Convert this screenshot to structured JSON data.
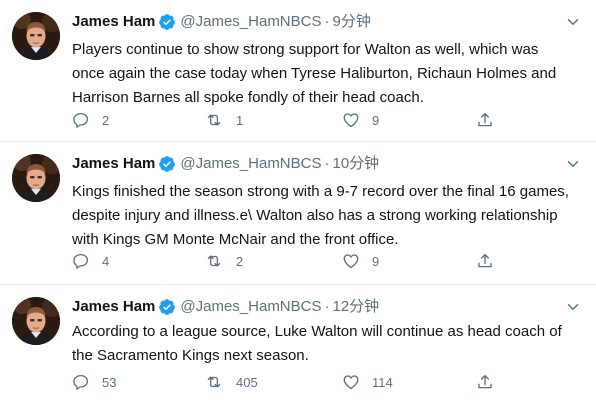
{
  "tweets": [
    {
      "name": "James Ham",
      "handle": "@James_HamNBCS",
      "dot": "·",
      "time": "9分钟",
      "text": "Players continue to show strong support for Walton as well, which was once again the case today when Tyrese Haliburton, Richaun Holmes and Harrison Barnes all spoke fondly of their head coach.",
      "replies": "2",
      "retweets": "1",
      "likes": "9"
    },
    {
      "name": "James Ham",
      "handle": "@James_HamNBCS",
      "dot": "·",
      "time": "10分钟",
      "text": "Kings finished the season strong with a 9-7 record over the final 16 games, despite injury and illness.e\\ Walton also has a strong working relationship with Kings GM Monte McNair and the front office.",
      "replies": "4",
      "retweets": "2",
      "likes": "9"
    },
    {
      "name": "James Ham",
      "handle": "@James_HamNBCS",
      "dot": "·",
      "time": "12分钟",
      "text": "According to a league source, Luke Walton will continue as head coach of the Sacramento Kings next season.",
      "replies": "53",
      "retweets": "405",
      "likes": "114"
    }
  ],
  "colors": {
    "text": "#0f1419",
    "secondary": "#5b7083",
    "verified": "#1da1f2",
    "divider": "#e6ecf0"
  },
  "icons": {
    "verified": "verified-badge-icon",
    "caret": "chevron-down-icon",
    "reply": "reply-icon",
    "retweet": "retweet-icon",
    "like": "heart-icon",
    "share": "share-icon"
  }
}
